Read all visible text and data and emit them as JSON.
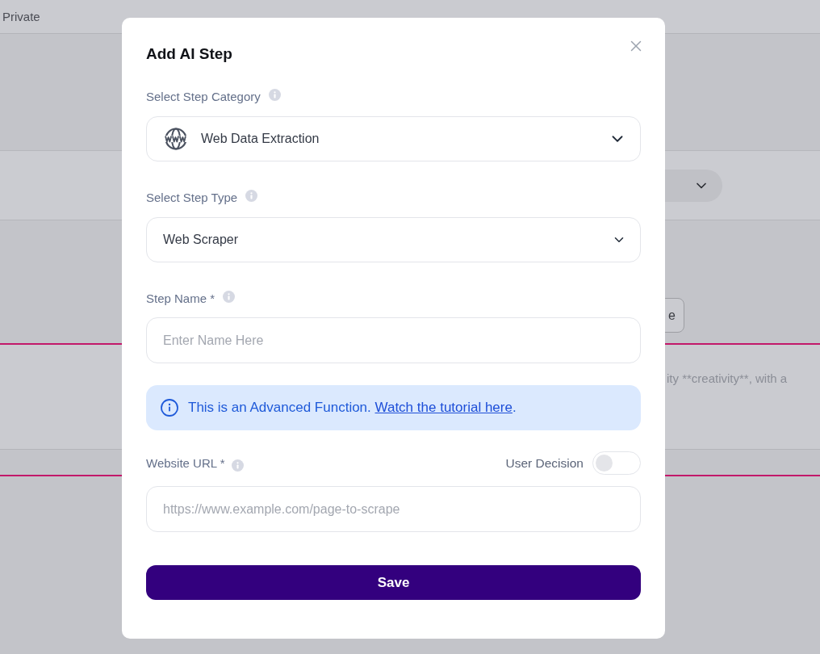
{
  "background": {
    "header_label": "Private",
    "button_text": "e",
    "text_snippet": "ity **creativity**, with a"
  },
  "dialog": {
    "title": "Add AI Step",
    "items": [
      {
        "kind": "iconselect",
        "label": "Select Step Category",
        "value": "Web Data Extraction"
      },
      {
        "kind": "select",
        "label": "Select Step Type",
        "value": "Web Scraper"
      },
      {
        "kind": "input",
        "label": "Step Name *",
        "placeholder": "Enter Name Here"
      },
      {
        "kind": "notice",
        "text": "This is an Advanced Function. ",
        "link": "Watch the tutorial here",
        "suffix": "."
      },
      {
        "kind": "input",
        "label": "Website URL *",
        "placeholder": "https://www.example.com/page-to-scrape",
        "toggle": {
          "label": "User Decision",
          "on": false
        }
      }
    ],
    "save_button": "Save"
  }
}
